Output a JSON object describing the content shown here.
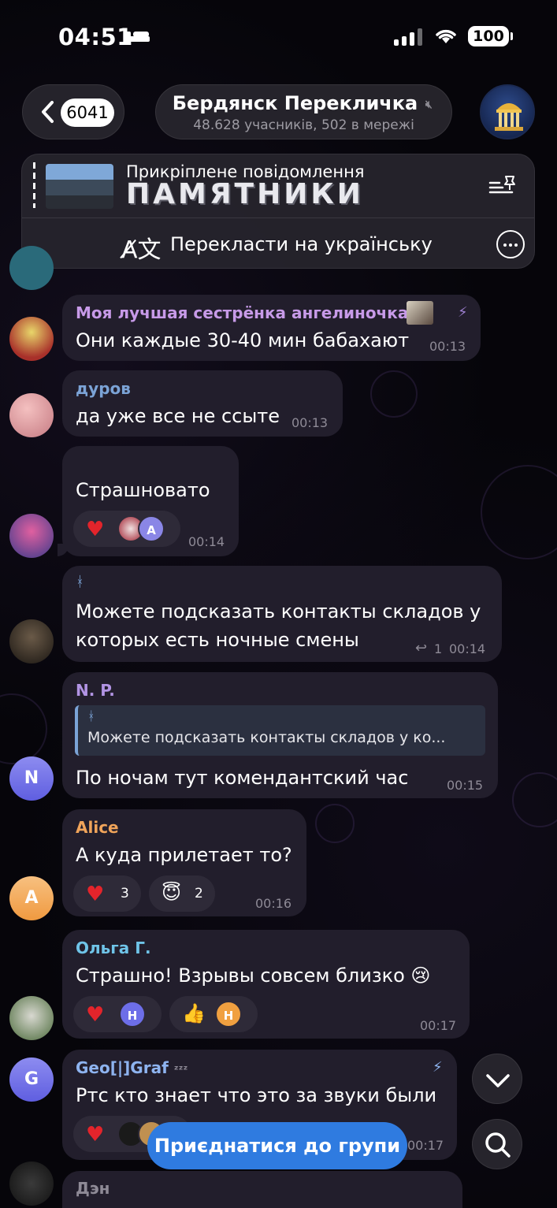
{
  "status_bar": {
    "time": "04:51",
    "battery": "100"
  },
  "header": {
    "back_count": "6041",
    "title": "Бердянск Перекличка",
    "subtitle": "48.628 учасників, 502 в мережі"
  },
  "pinned": {
    "title": "Прикріплене повідомлення",
    "text": "ПАМЯТНИКИ",
    "translate_label": "Перекласти на українську"
  },
  "messages": [
    {
      "sender": "Моя лучшая сестрёнка ангелиночка",
      "sender_color": "#c79ae8",
      "text": "Они каждые 30-40 мин бабахают",
      "time": "00:13"
    },
    {
      "sender": "дуров",
      "sender_color": "#7ba3d6",
      "text": "да уже все не ссыте",
      "time": "00:13"
    },
    {
      "text": "Страшновато",
      "time": "00:14",
      "reaction_avatar": "A"
    },
    {
      "sender_icon": "ᚼ",
      "text_line1": "Можете подсказать контакты складов у",
      "text_line2": "которых есть ночные смены",
      "replies": "1",
      "time": "00:14"
    },
    {
      "sender": "N. P.",
      "sender_color": "#b294e4",
      "reply_icon": "ᚼ",
      "reply_text": "Можете подсказать контакты складов у ко...",
      "text": "По ночам тут комендантский час",
      "time": "00:15",
      "avatar_letter": "N"
    },
    {
      "sender": "Alice",
      "sender_color": "#f0a45a",
      "text": "А куда прилетает то?",
      "reaction1_count": "3",
      "reaction2_count": "2",
      "time": "00:16",
      "avatar_letter": "A"
    },
    {
      "sender": "Ольга Г.",
      "sender_color": "#6fc4e8",
      "text": "Страшно! Взрывы совсем близко 😢",
      "reaction1_avatar": "H",
      "reaction2_avatar": "H",
      "time": "00:17"
    },
    {
      "sender": "Geo[|]Graf",
      "sender_color": "#8eb4f0",
      "sender_suffix": "ᶻᶻᶻ",
      "text": "Ртс кто знает что это за звуки были",
      "time": "00:17",
      "avatar_letter": "G"
    },
    {
      "sender": "Дэн",
      "sender_color": "#8e8a96"
    }
  ],
  "join_button": "Приєднатися до групи",
  "colors": {
    "accent": "#2f7be0",
    "bubble": "#221e2c",
    "heart": "#e3242b"
  }
}
